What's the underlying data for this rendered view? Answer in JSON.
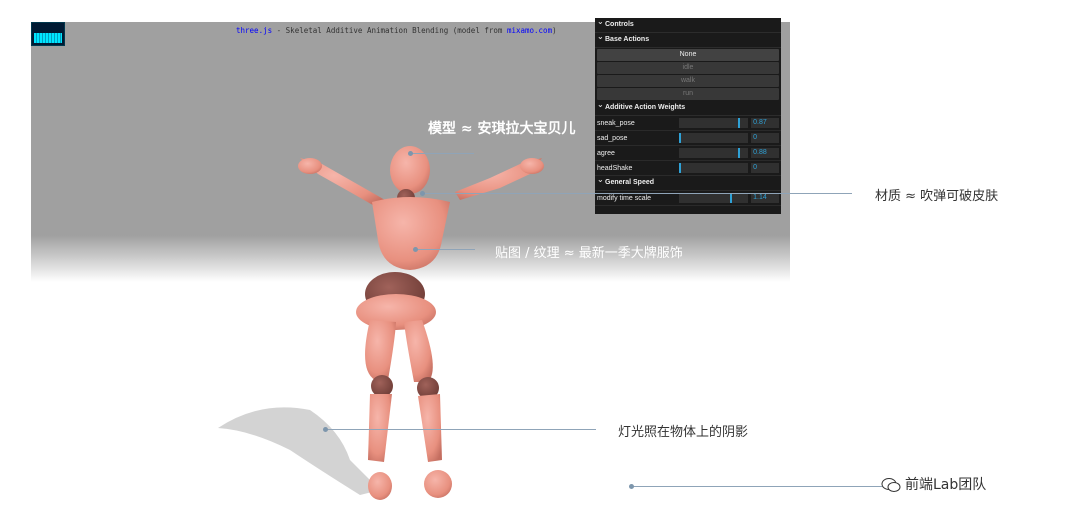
{
  "page": {
    "title_prefix": "three.js",
    "title_middle": " - Skeletal Additive Animation Blending (model from ",
    "title_link": "mixamo.com",
    "title_suffix": ")"
  },
  "gui": {
    "controls_label": "Controls",
    "base_actions_label": "Base Actions",
    "base_actions": [
      "None",
      "idle",
      "walk",
      "run"
    ],
    "additive_label": "Additive Action Weights",
    "weights": [
      {
        "name": "sneak_pose",
        "value": "0.87",
        "level": 0.87
      },
      {
        "name": "sad_pose",
        "value": "0",
        "level": 0
      },
      {
        "name": "agree",
        "value": "0.88",
        "level": 0.88
      },
      {
        "name": "headShake",
        "value": "0",
        "level": 0
      }
    ],
    "speed_label": "General Speed",
    "speed": {
      "name": "modify time scale",
      "value": "1.14",
      "level": 0.76
    }
  },
  "annotations": {
    "model": "模型 ≈ 安琪拉大宝贝儿",
    "material": "材质 ≈ 吹弹可破皮肤",
    "texture": "贴图 / 纹理 ≈  最新一季大牌服饰",
    "light": "灯光照在物体上的阴影"
  },
  "watermark": "前端Lab团队",
  "colors": {
    "skin": "#f0a195",
    "skin_dark": "#8a5048",
    "accent": "#2fa1d6"
  }
}
